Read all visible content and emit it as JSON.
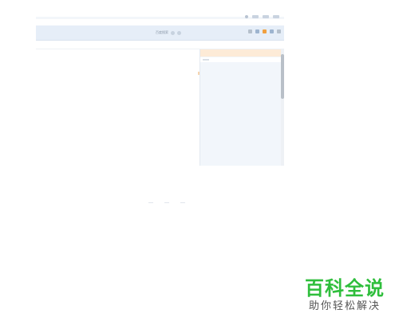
{
  "toolbar": {
    "search_text": "百度搜索",
    "icons": [
      "refresh-icon",
      "favorite-icon",
      "extension-icon",
      "menu-icon"
    ]
  },
  "watermark": {
    "title": "百科全说",
    "subtitle": "助你轻松解决"
  },
  "colors": {
    "toolbar_bg": "#e6eef8",
    "side_panel_bg": "#f2f6fb",
    "side_header_bg": "#fdebd7",
    "watermark_green": "#2fbe3c"
  }
}
